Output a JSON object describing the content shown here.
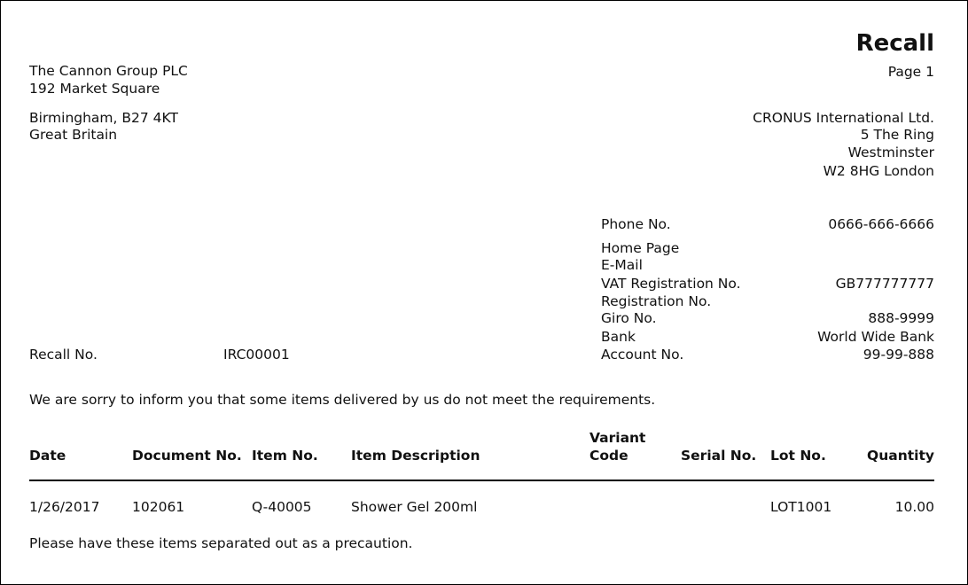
{
  "report": {
    "title": "Recall",
    "page_label": "Page 1"
  },
  "vendor": {
    "name": "The Cannon Group PLC",
    "address1": "192 Market Square",
    "city_line": "Birmingham, B27 4KT",
    "country": "Great Britain"
  },
  "company": {
    "name": "CRONUS International Ltd.",
    "address1": "5 The Ring",
    "address2": "Westminster",
    "city_line": "W2 8HG London"
  },
  "company_info": [
    {
      "label": "Phone No.",
      "value": "0666-666-6666"
    },
    {
      "label": "Home Page",
      "value": ""
    },
    {
      "label": "E-Mail",
      "value": ""
    },
    {
      "label": "VAT Registration No.",
      "value": "GB777777777"
    },
    {
      "label": "Registration No.",
      "value": ""
    },
    {
      "label": "Giro No.",
      "value": "888-9999"
    },
    {
      "label": "Bank",
      "value": "World Wide Bank"
    },
    {
      "label": "Account No.",
      "value": "99-99-888"
    }
  ],
  "recall": {
    "label": "Recall No.",
    "value": "IRC00001"
  },
  "intro_text": "We are sorry to inform you that some items delivered by us do not meet the requirements.",
  "table": {
    "headers": {
      "date": "Date",
      "document_no": "Document No.",
      "item_no": "Item No.",
      "item_description": "Item Description",
      "variant_code_line1": "Variant",
      "variant_code_line2": "Code",
      "serial_no": "Serial No.",
      "lot_no": "Lot No.",
      "quantity": "Quantity"
    },
    "rows": [
      {
        "date": "1/26/2017",
        "document_no": "102061",
        "item_no": "Q-40005",
        "item_description": "Shower Gel 200ml",
        "variant_code": "",
        "serial_no": "",
        "lot_no": "LOT1001",
        "quantity": "10.00"
      }
    ]
  },
  "closing_text": "Please have these items separated out as a precaution."
}
